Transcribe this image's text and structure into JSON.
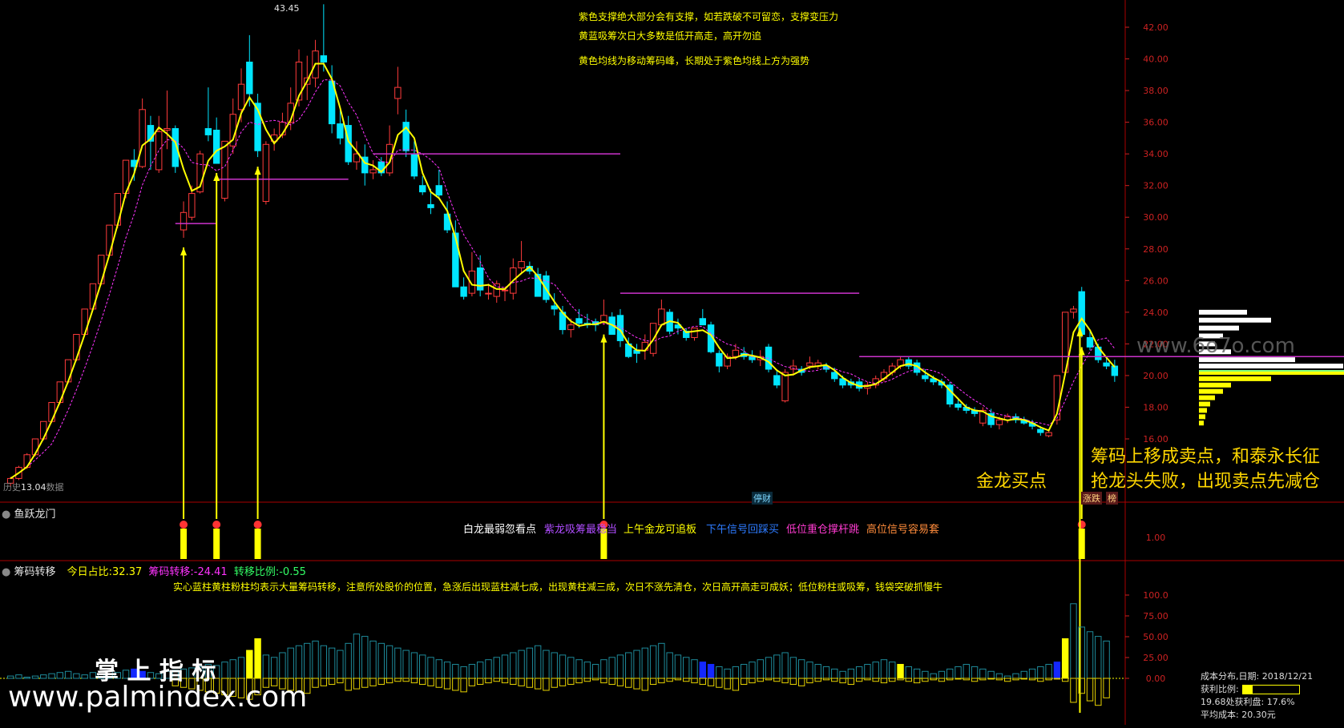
{
  "colors": {
    "up": "#ff3b3b",
    "down": "#00e5ff",
    "ma": "#ffff00",
    "ma2": "#ff33ff",
    "support": "#cc33cc",
    "arrow": "#ffff00",
    "axis": "#aa0000",
    "tick": "#cc2222",
    "blueBar": "#1428ff",
    "tealBar": "#1e8a9a"
  },
  "header": {
    "high_label": "43.45",
    "low_label": "13.04",
    "low_prefix": "历史",
    "low_suffix": "数据"
  },
  "notes": [
    "紫色支撑绝大部分会有支撑，如若跌破不可留恋，支撑变压力",
    "黄蓝吸筹次日大多数是低开高走，高开勿追",
    "黄色均线为移动筹码峰，长期处于紫色均线上方为强势"
  ],
  "annotations": {
    "buy": "金龙买点",
    "sell_line1": "筹码上移成卖点，和泰永长征",
    "sell_line2": "抢龙头失败，出现卖点先减仓",
    "stop_badge": "停财",
    "tag1": "涨跌",
    "tag2": "榜"
  },
  "indicator1": {
    "title": "鱼跃龙门",
    "legend": [
      {
        "text": "白龙最弱忽看点",
        "color": "#ffffff"
      },
      {
        "text": "紫龙吸筹最稳当",
        "color": "#b04dff"
      },
      {
        "text": "上午金龙可追板",
        "color": "#ffff00"
      },
      {
        "text": "下午信号回踩买",
        "color": "#2d7bff"
      },
      {
        "text": "低位重仓撑杆跳",
        "color": "#ff3bd1"
      },
      {
        "text": "高位信号容易套",
        "color": "#ff8c3b"
      }
    ],
    "axis_label": "1.00"
  },
  "indicator2": {
    "title": "筹码转移",
    "today_label": "今日占比:",
    "today_value": "32.37",
    "transfer_label": "筹码转移:",
    "transfer_value": "-24.41",
    "ratio_label": "转移比例:",
    "ratio_value": "-0.55",
    "note": "实心蓝柱黄柱粉柱均表示大量筹码转移，注意所处股价的位置，急涨后出现蓝柱减七成，出现黄柱减三成，次日不涨先清仓，次日高开高走可成妖；低位粉柱或吸筹，钱袋突破抓慢牛",
    "axis_labels": [
      "100.0",
      "75.00",
      "50.00",
      "25.00",
      "0.00"
    ]
  },
  "cost_box": {
    "title": "成本分布,日期:",
    "date": "2018/12/21",
    "profit_label": "获利比例:",
    "profit_fill_pct": 17.6,
    "profit_row": "19.68处获利盘: 17.6%",
    "avg_row": "平均成本: 20.30元"
  },
  "watermarks": {
    "site1": "www.palmindex.com",
    "site1_cn": "掌 上 指 标",
    "site2": "www.6o7o.com"
  },
  "chart_data": {
    "type": "candlestick",
    "y_axis_labels": [
      "42.00",
      "40.00",
      "38.00",
      "36.00",
      "34.00",
      "32.00",
      "30.00",
      "28.00",
      "26.00",
      "24.00",
      "22.00",
      "20.00",
      "18.00",
      "16.00"
    ],
    "ylim": [
      13.0,
      43.6
    ],
    "candles": [
      [
        13.2,
        13.6,
        13.0,
        13.5
      ],
      [
        13.5,
        14.3,
        13.4,
        14.2
      ],
      [
        14.2,
        15.1,
        14.1,
        15.0
      ],
      [
        15.0,
        16.0,
        14.9,
        16.0
      ],
      [
        16.0,
        17.1,
        15.9,
        17.1
      ],
      [
        17.1,
        18.3,
        17.0,
        18.3
      ],
      [
        18.3,
        19.6,
        18.2,
        19.6
      ],
      [
        19.6,
        21.0,
        19.5,
        21.0
      ],
      [
        21.0,
        22.6,
        20.9,
        22.6
      ],
      [
        22.6,
        24.2,
        22.5,
        24.2
      ],
      [
        24.2,
        25.8,
        24.1,
        25.8
      ],
      [
        25.8,
        27.6,
        25.7,
        27.6
      ],
      [
        27.6,
        29.5,
        27.5,
        29.5
      ],
      [
        29.5,
        31.5,
        29.3,
        31.5
      ],
      [
        31.5,
        33.6,
        31.2,
        33.6
      ],
      [
        33.6,
        34.3,
        32.3,
        33.2
      ],
      [
        33.2,
        37.5,
        33.1,
        36.8
      ],
      [
        35.8,
        36.4,
        33.0,
        34.8
      ],
      [
        33.0,
        36.4,
        32.8,
        35.4
      ],
      [
        35.5,
        38.0,
        34.3,
        35.6
      ],
      [
        35.6,
        35.8,
        32.8,
        33.2
      ],
      [
        29.2,
        31.0,
        28.7,
        30.3
      ],
      [
        30.0,
        32.0,
        29.8,
        31.5
      ],
      [
        31.6,
        34.2,
        31.5,
        34.0
      ],
      [
        35.6,
        38.2,
        34.8,
        35.2
      ],
      [
        35.5,
        36.3,
        33.4,
        33.4
      ],
      [
        31.2,
        34.8,
        31.0,
        34.8
      ],
      [
        34.5,
        37.5,
        34.0,
        36.5
      ],
      [
        36.8,
        39.4,
        36.0,
        38.4
      ],
      [
        39.8,
        41.5,
        37.0,
        37.8
      ],
      [
        37.2,
        37.8,
        33.8,
        34.2
      ],
      [
        31.0,
        34.8,
        30.8,
        34.6
      ],
      [
        34.8,
        35.6,
        34.2,
        35.2
      ],
      [
        35.2,
        36.6,
        35.0,
        36.0
      ],
      [
        36.0,
        38.2,
        35.5,
        37.2
      ],
      [
        37.4,
        40.6,
        37.0,
        39.8
      ],
      [
        38.4,
        40.2,
        37.4,
        38.8
      ],
      [
        38.8,
        41.2,
        38.2,
        40.5
      ],
      [
        40.2,
        43.45,
        39.2,
        39.8
      ],
      [
        38.6,
        39.6,
        35.3,
        35.9
      ],
      [
        35.9,
        36.8,
        34.6,
        35.0
      ],
      [
        35.8,
        36.4,
        33.3,
        33.5
      ],
      [
        33.5,
        34.8,
        33.0,
        34.0
      ],
      [
        33.8,
        34.6,
        32.0,
        32.8
      ],
      [
        32.8,
        33.6,
        32.4,
        33.0
      ],
      [
        33.5,
        33.8,
        32.6,
        32.8
      ],
      [
        32.8,
        35.8,
        32.6,
        34.6
      ],
      [
        37.5,
        39.5,
        36.5,
        38.2
      ],
      [
        36.0,
        36.8,
        33.8,
        34.2
      ],
      [
        34.0,
        34.8,
        32.4,
        32.6
      ],
      [
        32.0,
        32.6,
        31.4,
        31.6
      ],
      [
        30.8,
        31.8,
        30.2,
        30.6
      ],
      [
        32.0,
        33.0,
        31.2,
        31.4
      ],
      [
        30.2,
        31.0,
        29.0,
        29.2
      ],
      [
        29.0,
        29.8,
        25.6,
        25.6
      ],
      [
        25.6,
        26.2,
        24.8,
        25.0
      ],
      [
        25.2,
        27.8,
        25.0,
        26.6
      ],
      [
        26.8,
        27.6,
        25.0,
        25.4
      ],
      [
        25.2,
        25.8,
        24.8,
        25.2
      ],
      [
        25.0,
        26.0,
        24.6,
        25.8
      ],
      [
        25.4,
        25.6,
        24.7,
        25.4
      ],
      [
        25.2,
        27.4,
        24.8,
        26.8
      ],
      [
        26.8,
        28.5,
        26.4,
        27.2
      ],
      [
        26.9,
        27.2,
        26.4,
        26.6
      ],
      [
        26.4,
        26.8,
        25.0,
        25.0
      ],
      [
        26.3,
        26.6,
        24.6,
        24.8
      ],
      [
        24.4,
        25.2,
        23.8,
        24.2
      ],
      [
        24.0,
        24.4,
        22.6,
        22.9
      ],
      [
        22.9,
        23.6,
        22.4,
        23.2
      ],
      [
        23.6,
        24.2,
        23.0,
        23.3
      ],
      [
        23.3,
        23.9,
        23.0,
        23.2
      ],
      [
        23.4,
        23.6,
        22.8,
        23.2
      ],
      [
        23.4,
        24.8,
        23.2,
        23.8
      ],
      [
        23.7,
        24.0,
        22.6,
        22.6
      ],
      [
        23.8,
        24.2,
        21.8,
        22.2
      ],
      [
        22.0,
        22.4,
        21.1,
        21.2
      ],
      [
        21.6,
        22.0,
        20.8,
        21.4
      ],
      [
        21.6,
        22.6,
        21.0,
        22.1
      ],
      [
        21.4,
        23.2,
        21.2,
        23.3
      ],
      [
        23.2,
        24.8,
        23.1,
        24.2
      ],
      [
        24.0,
        24.2,
        22.6,
        22.8
      ],
      [
        23.2,
        23.6,
        22.6,
        23.0
      ],
      [
        22.8,
        23.0,
        22.2,
        22.4
      ],
      [
        22.4,
        23.0,
        22.2,
        23.0
      ],
      [
        23.6,
        24.2,
        23.2,
        23.2
      ],
      [
        23.2,
        23.4,
        21.4,
        21.5
      ],
      [
        21.4,
        21.6,
        20.2,
        20.6
      ],
      [
        20.6,
        21.4,
        20.4,
        21.2
      ],
      [
        21.2,
        22.0,
        21.0,
        21.6
      ],
      [
        21.4,
        21.8,
        21.0,
        21.2
      ],
      [
        21.2,
        21.6,
        20.8,
        21.0
      ],
      [
        21.0,
        21.6,
        20.6,
        21.2
      ],
      [
        21.8,
        22.0,
        20.2,
        20.4
      ],
      [
        20.0,
        20.4,
        19.2,
        19.4
      ],
      [
        18.4,
        20.4,
        18.3,
        20.2
      ],
      [
        20.4,
        21.0,
        20.0,
        20.6
      ],
      [
        20.4,
        20.6,
        20.0,
        20.2
      ],
      [
        20.6,
        21.2,
        20.4,
        20.8
      ],
      [
        20.6,
        21.0,
        20.4,
        20.8
      ],
      [
        20.6,
        20.8,
        20.2,
        20.4
      ],
      [
        20.2,
        20.5,
        19.6,
        19.8
      ],
      [
        19.8,
        20.0,
        19.2,
        19.4
      ],
      [
        19.6,
        19.8,
        19.2,
        19.4
      ],
      [
        19.6,
        19.8,
        19.0,
        19.2
      ],
      [
        19.2,
        19.6,
        18.8,
        19.4
      ],
      [
        19.4,
        20.0,
        19.2,
        19.8
      ],
      [
        19.8,
        20.4,
        19.6,
        20.2
      ],
      [
        20.2,
        20.8,
        20.0,
        20.6
      ],
      [
        20.6,
        21.2,
        20.4,
        21.0
      ],
      [
        21.0,
        21.2,
        20.4,
        20.6
      ],
      [
        20.8,
        21.0,
        20.0,
        20.2
      ],
      [
        20.0,
        20.4,
        19.6,
        19.8
      ],
      [
        19.8,
        20.0,
        19.4,
        19.6
      ],
      [
        19.6,
        19.8,
        19.2,
        19.4
      ],
      [
        19.4,
        19.6,
        18.0,
        18.2
      ],
      [
        18.2,
        18.6,
        17.8,
        18.0
      ],
      [
        18.0,
        18.2,
        17.6,
        17.8
      ],
      [
        17.8,
        18.0,
        17.4,
        17.6
      ],
      [
        17.0,
        18.0,
        16.8,
        17.8
      ],
      [
        17.6,
        17.9,
        16.7,
        16.9
      ],
      [
        16.9,
        17.4,
        16.6,
        17.2
      ],
      [
        17.2,
        17.6,
        17.0,
        17.4
      ],
      [
        17.4,
        17.6,
        17.0,
        17.2
      ],
      [
        17.2,
        17.4,
        16.9,
        17.0
      ],
      [
        17.0,
        17.2,
        16.6,
        16.8
      ],
      [
        16.6,
        16.8,
        16.2,
        16.4
      ],
      [
        16.2,
        16.6,
        16.1,
        16.4
      ],
      [
        17.2,
        20.0,
        16.9,
        20.0
      ],
      [
        20.2,
        24.0,
        20.0,
        24.0
      ],
      [
        24.0,
        24.4,
        23.6,
        24.2
      ],
      [
        25.3,
        25.6,
        22.4,
        22.6
      ],
      [
        22.4,
        22.8,
        21.6,
        21.8
      ],
      [
        21.8,
        22.0,
        20.8,
        21.0
      ],
      [
        20.8,
        21.2,
        20.4,
        20.6
      ],
      [
        20.6,
        21.0,
        19.6,
        20.0
      ]
    ],
    "ma_yellow": [],
    "support_lines": [
      {
        "level": 29.6,
        "from": 20,
        "to": 25
      },
      {
        "level": 32.4,
        "from": 25,
        "to": 41
      },
      {
        "level": 34.0,
        "from": 44,
        "to": 74
      },
      {
        "level": 25.2,
        "from": 74,
        "to": 103
      },
      {
        "level": 21.2,
        "from": 103,
        "to": 176
      },
      {
        "level": 16.4,
        "from": 176,
        "to": 186
      }
    ],
    "signal_indices": [
      21,
      25,
      30,
      72,
      130
    ],
    "chip_values": [
      2,
      3,
      1,
      2,
      3,
      4,
      5,
      6,
      4,
      3,
      5,
      4,
      6,
      5,
      7,
      8,
      6,
      5,
      4,
      6,
      7,
      8,
      9,
      10,
      12,
      11,
      14,
      16,
      18,
      24,
      34,
      20,
      18,
      22,
      26,
      28,
      30,
      32,
      28,
      26,
      24,
      30,
      38,
      36,
      32,
      30,
      28,
      26,
      24,
      22,
      20,
      18,
      16,
      14,
      12,
      10,
      12,
      14,
      16,
      18,
      20,
      22,
      24,
      26,
      28,
      24,
      22,
      20,
      18,
      16,
      14,
      12,
      16,
      18,
      20,
      22,
      24,
      26,
      28,
      30,
      22,
      20,
      18,
      16,
      14,
      12,
      10,
      8,
      10,
      12,
      14,
      16,
      18,
      20,
      22,
      18,
      16,
      14,
      12,
      10,
      8,
      6,
      8,
      10,
      12,
      14,
      16,
      14,
      12,
      10,
      8,
      6,
      4,
      6,
      8,
      10,
      12,
      10,
      8,
      6,
      4,
      2,
      4,
      6,
      8,
      10,
      12,
      14,
      34,
      64,
      44,
      40,
      36,
      32
    ],
    "chip_neg": [
      0,
      0,
      0,
      0,
      0,
      0,
      0,
      0,
      0,
      0,
      0,
      0,
      0,
      0,
      0,
      0,
      0,
      0,
      0,
      0,
      10,
      12,
      14,
      16,
      18,
      20,
      22,
      24,
      26,
      28,
      22,
      12,
      10,
      14,
      16,
      18,
      20,
      12,
      10,
      8,
      6,
      16,
      14,
      12,
      10,
      8,
      6,
      4,
      4,
      6,
      8,
      10,
      12,
      14,
      16,
      18,
      10,
      8,
      6,
      4,
      6,
      8,
      10,
      12,
      14,
      16,
      12,
      10,
      8,
      6,
      4,
      2,
      6,
      8,
      10,
      12,
      14,
      16,
      8,
      6,
      4,
      2,
      4,
      6,
      8,
      10,
      12,
      14,
      16,
      8,
      6,
      4,
      2,
      4,
      6,
      8,
      10,
      6,
      4,
      2,
      4,
      6,
      8,
      4,
      2,
      4,
      6,
      4,
      2,
      4,
      6,
      4,
      2,
      4,
      2,
      1,
      2,
      4,
      2,
      1,
      2,
      4,
      2,
      1,
      2,
      4,
      2,
      1,
      4,
      32,
      20,
      30,
      36,
      26
    ],
    "chip_colors_special": {
      "15": "#1428ff",
      "16": "#1428ff",
      "29": "#ffff00",
      "30": "#ffff00",
      "84": "#1428ff",
      "85": "#1428ff",
      "108": "#ffff00",
      "127": "#1428ff",
      "128": "#ffff00"
    }
  }
}
